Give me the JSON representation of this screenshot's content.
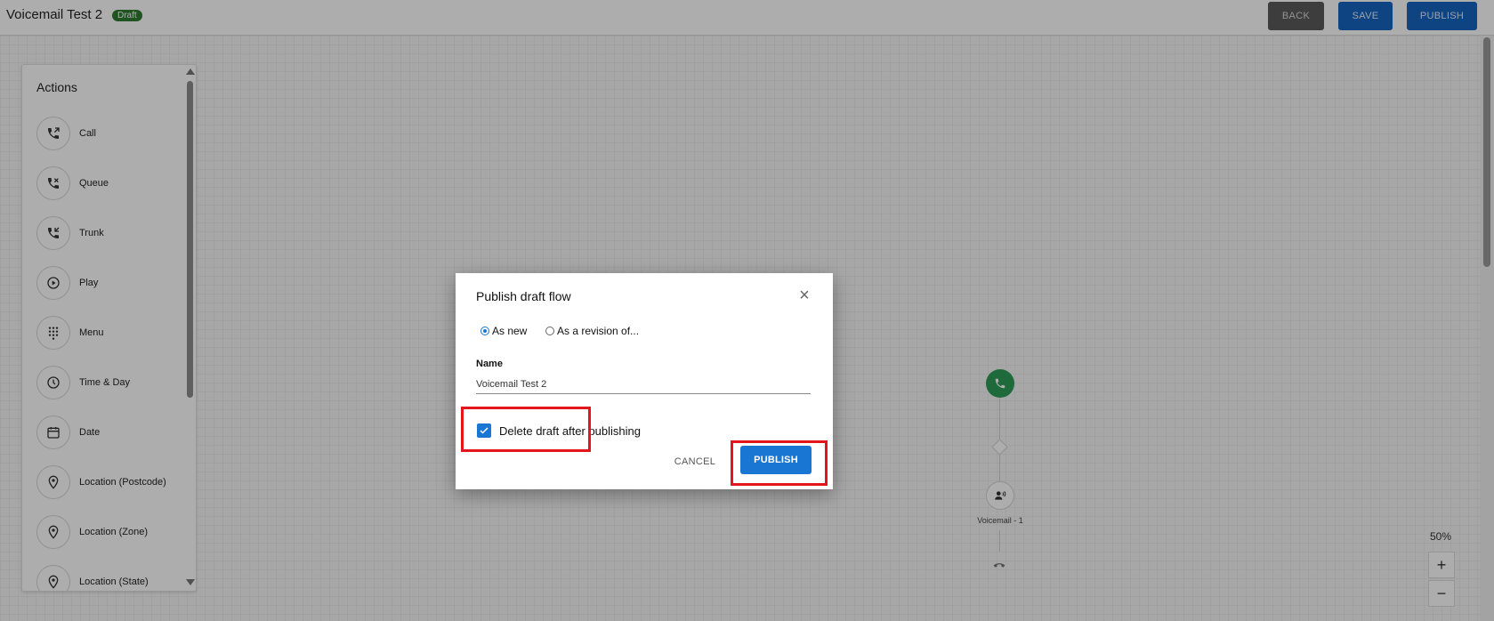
{
  "header": {
    "flow_title": "Voicemail Test 2",
    "badge": "Draft",
    "back_label": "BACK",
    "save_label": "SAVE",
    "publish_label": "PUBLISH"
  },
  "actions_panel": {
    "title": "Actions",
    "items": [
      {
        "label": "Call",
        "icon": "phone-outgoing-icon"
      },
      {
        "label": "Queue",
        "icon": "phone-queue-icon"
      },
      {
        "label": "Trunk",
        "icon": "phone-trunk-icon"
      },
      {
        "label": "Play",
        "icon": "play-circle-icon"
      },
      {
        "label": "Menu",
        "icon": "dialpad-icon"
      },
      {
        "label": "Time & Day",
        "icon": "clock-icon"
      },
      {
        "label": "Date",
        "icon": "calendar-icon"
      },
      {
        "label": "Location (Postcode)",
        "icon": "location-pin-icon"
      },
      {
        "label": "Location (Zone)",
        "icon": "location-pin-icon"
      },
      {
        "label": "Location (State)",
        "icon": "location-pin-icon"
      }
    ]
  },
  "canvas": {
    "voicemail_node_label": "Voicemail - 1",
    "zoom_level": "50%"
  },
  "dialog": {
    "title": "Publish draft flow",
    "option_new": "As new",
    "option_revision": "As a revision of...",
    "selected_option": "As new",
    "name_label": "Name",
    "name_value": "Voicemail Test 2",
    "delete_draft_label": "Delete draft after publishing",
    "delete_draft_checked": true,
    "cancel_label": "CANCEL",
    "publish_label": "PUBLISH"
  },
  "colors": {
    "primary": "#1976d2",
    "highlight": "#e3161b",
    "start_node": "#2e9d57",
    "draft_badge": "#2e7d32"
  }
}
